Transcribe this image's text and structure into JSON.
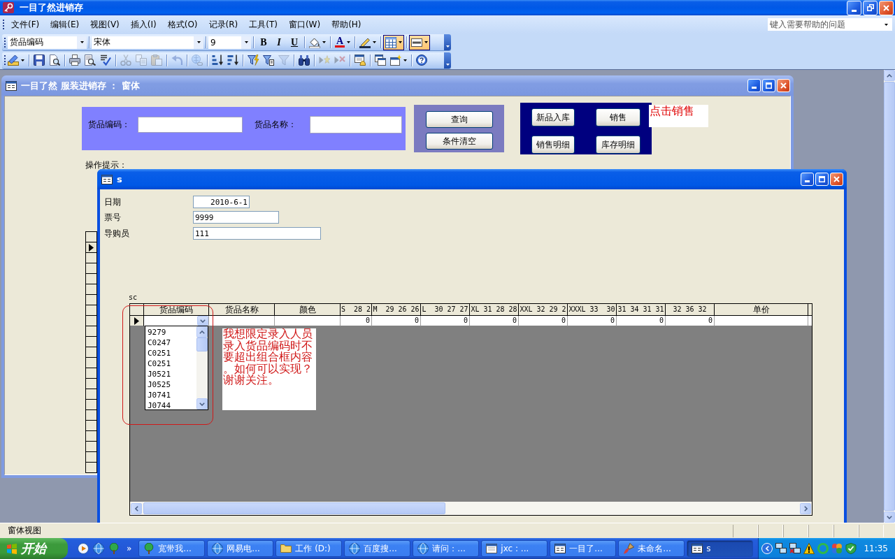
{
  "app": {
    "title": "一目了然进销存",
    "maximized": true
  },
  "menu": [
    "文件(F)",
    "编辑(E)",
    "视图(V)",
    "插入(I)",
    "格式(O)",
    "记录(R)",
    "工具(T)",
    "窗口(W)",
    "帮助(H)"
  ],
  "help_box": {
    "placeholder": "键入需要帮助的问题"
  },
  "format_toolbar": {
    "object_combo": "货品编码",
    "font_combo": "宋体",
    "size_combo": "9",
    "groups": [
      [
        {
          "kind": "bold",
          "label": "B",
          "pressed": false
        },
        {
          "kind": "italic",
          "label": "I",
          "pressed": false
        },
        {
          "kind": "underline",
          "label": "U",
          "pressed": false
        }
      ],
      [
        {
          "kind": "fill",
          "pressed": false
        }
      ],
      [
        {
          "kind": "fontcolor",
          "label": "A",
          "pressed": false
        }
      ],
      [
        {
          "kind": "linecolor",
          "pressed": false
        }
      ],
      [
        {
          "kind": "effect",
          "pressed": true
        }
      ],
      [
        {
          "kind": "border",
          "pressed": true
        }
      ]
    ]
  },
  "database_toolbar": {
    "groups": [
      [
        {
          "kind": "view",
          "disabled": false
        }
      ],
      [
        {
          "kind": "save",
          "disabled": false
        },
        {
          "kind": "search",
          "disabled": false
        }
      ],
      [
        {
          "kind": "print",
          "disabled": false
        },
        {
          "kind": "preview",
          "disabled": false
        },
        {
          "kind": "spelling",
          "disabled": false
        }
      ],
      [
        {
          "kind": "cut",
          "disabled": true
        },
        {
          "kind": "copy",
          "disabled": true
        },
        {
          "kind": "paste",
          "disabled": true
        }
      ],
      [
        {
          "kind": "undo",
          "disabled": true
        }
      ],
      [
        {
          "kind": "hyperlink",
          "disabled": true
        }
      ],
      [
        {
          "kind": "sortup",
          "disabled": false
        },
        {
          "kind": "sortdown",
          "disabled": false
        }
      ],
      [
        {
          "kind": "filtersel",
          "disabled": false
        },
        {
          "kind": "filterform",
          "disabled": false
        },
        {
          "kind": "filter",
          "disabled": true
        }
      ],
      [
        {
          "kind": "find",
          "disabled": false
        }
      ],
      [
        {
          "kind": "newrec",
          "disabled": true
        },
        {
          "kind": "delrec",
          "disabled": true
        }
      ],
      [
        {
          "kind": "properties",
          "disabled": false
        }
      ],
      [
        {
          "kind": "dbwindow",
          "disabled": false
        },
        {
          "kind": "newobject",
          "disabled": false
        }
      ],
      [
        {
          "kind": "help",
          "disabled": false
        }
      ]
    ]
  },
  "main_form": {
    "title": "一目了然 服装进销存 ： 窗体",
    "search_fields": [
      {
        "label": "货品编码："
      },
      {
        "label": "货品名称："
      }
    ],
    "query_buttons": [
      "查询",
      "条件清空"
    ],
    "nav_buttons": [
      "新品入库",
      "销售",
      "销售明细",
      "库存明细"
    ],
    "note": "点击销售",
    "hint": "操作提示：",
    "record_selectors": [
      {
        "selected": false
      },
      {
        "selected": true
      },
      {
        "selected": false
      },
      {
        "selected": false
      },
      {
        "selected": false
      },
      {
        "selected": false
      },
      {
        "selected": false
      },
      {
        "selected": false
      },
      {
        "selected": false
      },
      {
        "selected": false
      },
      {
        "selected": false
      },
      {
        "selected": false
      },
      {
        "selected": false
      },
      {
        "selected": false
      },
      {
        "selected": false
      },
      {
        "selected": false
      },
      {
        "selected": false
      },
      {
        "selected": false
      },
      {
        "selected": false
      },
      {
        "selected": false
      },
      {
        "selected": false
      },
      {
        "selected": false
      },
      {
        "selected": false
      }
    ]
  },
  "subform": {
    "title": "s",
    "fields": [
      {
        "label": "日期",
        "value": "2010-6-1",
        "kind": "date"
      },
      {
        "label": "票号",
        "value": "9999",
        "kind": "text"
      },
      {
        "label": "导购员",
        "value": "111",
        "kind": "text"
      }
    ],
    "datasheet_label": "sc",
    "datasheet": {
      "columns": [
        {
          "label": "货品编码",
          "kind": "combo"
        },
        {
          "label": "货品名称",
          "kind": "text"
        },
        {
          "label": "颜色",
          "kind": "text"
        },
        {
          "label": "S  28 2",
          "kind": "number",
          "value": "0"
        },
        {
          "label": "M  29 26 26",
          "kind": "number",
          "value": "0"
        },
        {
          "label": "L  30 27 27",
          "kind": "number",
          "value": "0"
        },
        {
          "label": "XL 31 28 28",
          "kind": "number",
          "value": "0"
        },
        {
          "label": "XXL 32 29 2",
          "kind": "number",
          "value": "0"
        },
        {
          "label": "XXXL 33  30",
          "kind": "number",
          "value": "0"
        },
        {
          "label": "31 34 31 31",
          "kind": "number",
          "value": "0"
        },
        {
          "label": "32 36 32",
          "kind": "number",
          "value": "0"
        },
        {
          "label": "单价",
          "kind": "text"
        }
      ],
      "row_selected": true,
      "dropdown": [
        "9279",
        "C0247",
        "C0251",
        "C0251",
        "J0521",
        "J0525",
        "J0741",
        "J0744"
      ]
    },
    "annotation": "我想限定录入人员录入货品编码时不要超出组合框内容。如何可以实现？谢谢关注。"
  },
  "status_bar": {
    "text": "窗体视图"
  },
  "taskbar": {
    "start": "开始",
    "quick_launch": [
      {
        "kind": "media"
      },
      {
        "kind": "browser"
      },
      {
        "kind": "tree"
      }
    ],
    "more": "»",
    "tasks": [
      {
        "label": "宽带我...",
        "kind": "tree",
        "selected": false
      },
      {
        "label": "网易电...",
        "kind": "browser",
        "selected": false
      },
      {
        "label": "工作 (D:)",
        "kind": "folder",
        "selected": false
      },
      {
        "label": "百度搜...",
        "kind": "browser",
        "selected": false
      },
      {
        "label": "请问：...",
        "kind": "browser",
        "selected": false
      },
      {
        "label": "jxc : ...",
        "kind": "window",
        "selected": false
      },
      {
        "label": "一目了...",
        "kind": "form",
        "selected": false
      },
      {
        "label": "未命名...",
        "kind": "brush",
        "selected": false
      },
      {
        "label": "s",
        "kind": "form",
        "selected": true
      }
    ],
    "tray": [
      {
        "kind": "network"
      },
      {
        "kind": "disconnected"
      },
      {
        "kind": "warning"
      },
      {
        "kind": "ring"
      },
      {
        "kind": "pinwheel"
      },
      {
        "kind": "shield"
      }
    ],
    "clock": "11:35"
  }
}
